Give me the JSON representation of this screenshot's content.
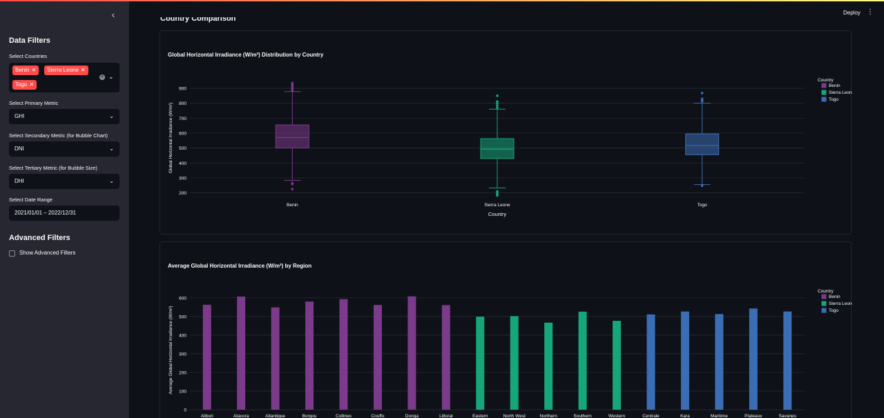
{
  "sidebar": {
    "collapse_icon": "chevron-left-icon",
    "title": "Data Filters",
    "countries_label": "Select Countries",
    "countries": [
      "Benin",
      "Sierra Leone",
      "Togo"
    ],
    "primary_label": "Select Primary Metric",
    "primary_value": "GHI",
    "secondary_label": "Select Secondary Metric (for Bubble Chart)",
    "secondary_value": "DNI",
    "tertiary_label": "Select Tertiary Metric (for Bubble Size)",
    "tertiary_value": "DHI",
    "date_label": "Select Date Range",
    "date_value": "2021/01/01 – 2022/12/31",
    "advanced_title": "Advanced Filters",
    "advanced_checkbox_label": "Show Advanced Filters"
  },
  "header": {
    "deploy_label": "Deploy",
    "menu_icon": "kebab-menu-icon"
  },
  "main": {
    "section_title": "Country Comparison"
  },
  "colors": {
    "Benin": "#7b3a8a",
    "Sierra Leone": "#17a57a",
    "Togo": "#3b6db5",
    "accent": "#ff4b4b"
  },
  "chart_data": [
    {
      "type": "box",
      "title": "Global Horizontal Irradiance (W/m²) Distribution by Country",
      "xlabel": "Country",
      "ylabel": "Global Horizontal Irradiance (W/m²)",
      "ylim": [
        175,
        960
      ],
      "yticks": [
        200,
        300,
        400,
        500,
        600,
        700,
        800,
        900
      ],
      "legend_title": "Country",
      "legend_position": "top-right",
      "categories": [
        "Benin",
        "Sierra Leone",
        "Togo"
      ],
      "boxes": [
        {
          "name": "Benin",
          "min": 283,
          "q1": 500,
          "median": 570,
          "q3": 655,
          "max": 878,
          "outliers": [
            225,
            258,
            265,
            885,
            895,
            905,
            915,
            925,
            935
          ]
        },
        {
          "name": "Sierra Leone",
          "min": 233,
          "q1": 430,
          "median": 493,
          "q3": 563,
          "max": 760,
          "outliers": [
            182,
            190,
            200,
            210,
            770,
            785,
            800,
            812,
            850
          ]
        },
        {
          "name": "Togo",
          "min": 255,
          "q1": 455,
          "median": 517,
          "q3": 595,
          "max": 800,
          "outliers": [
            248,
            812,
            820,
            830,
            868
          ]
        }
      ]
    },
    {
      "type": "bar",
      "title": "Average Global Horizontal Irradiance (W/m²) by Region",
      "ylabel": "Average Global Horizontal Irradiance (W/m²)",
      "ylim": [
        0,
        640
      ],
      "yticks": [
        0,
        100,
        200,
        300,
        400,
        500,
        600
      ],
      "legend_title": "Country",
      "legend_position": "top-right",
      "categories": [
        "Alibori",
        "Atacora",
        "Atlantique",
        "Borgou",
        "Collines",
        "Couffo",
        "Donga",
        "Littoral",
        "Eastern",
        "North West",
        "Northern",
        "Southern",
        "Western",
        "Centrale",
        "Kara",
        "Maritime",
        "Plateaux",
        "Savanes"
      ],
      "series_of": [
        "Benin",
        "Benin",
        "Benin",
        "Benin",
        "Benin",
        "Benin",
        "Benin",
        "Benin",
        "Sierra Leone",
        "Sierra Leone",
        "Sierra Leone",
        "Sierra Leone",
        "Sierra Leone",
        "Togo",
        "Togo",
        "Togo",
        "Togo",
        "Togo"
      ],
      "values": [
        563,
        607,
        549,
        580,
        593,
        562,
        608,
        561,
        499,
        502,
        467,
        526,
        477,
        511,
        527,
        513,
        543,
        527
      ]
    }
  ]
}
